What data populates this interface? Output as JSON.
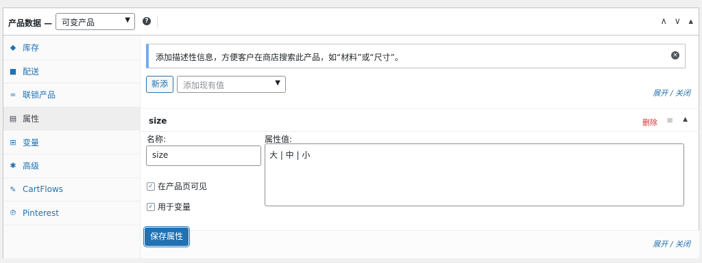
{
  "header": {
    "title": "产品数据 —",
    "product_type": "可变产品",
    "help_glyph": "?",
    "controls": [
      "∧",
      "∨",
      "▴"
    ]
  },
  "sidebar": {
    "items": [
      {
        "label": "库存",
        "icon": "tag-icon",
        "glyph": "◆"
      },
      {
        "label": "配送",
        "icon": "truck-icon",
        "glyph": "■"
      },
      {
        "label": "联锁产品",
        "icon": "link-icon",
        "glyph": "∞"
      },
      {
        "label": "属性",
        "icon": "list-icon",
        "glyph": "▤"
      },
      {
        "label": "变量",
        "icon": "grid-icon",
        "glyph": "⊞"
      },
      {
        "label": "高级",
        "icon": "gear-icon",
        "glyph": "✱"
      },
      {
        "label": "CartFlows",
        "icon": "wrench-icon",
        "glyph": "✎"
      },
      {
        "label": "Pinterest",
        "icon": "pinterest-icon",
        "glyph": "℗"
      }
    ],
    "active_index": 3
  },
  "notice": {
    "text": "添加描述性信息，方便客户在商店搜索此产品，如“材料”或“尺寸”。",
    "close_glyph": "×"
  },
  "toolbar": {
    "new_label": "新添",
    "existing_placeholder": "添加现有值",
    "expand_collapse": "展开 / 关闭"
  },
  "attribute": {
    "name_heading": "size",
    "delete_label": "删除",
    "drag_glyph": "≡",
    "toggle_glyph": "▲",
    "name_label": "名称:",
    "name_value": "size",
    "values_label": "属性值:",
    "values_value": "大 | 中 | 小",
    "visible_label": "在产品页可见",
    "visible_checked": true,
    "variation_label": "用于变量",
    "variation_checked": true,
    "check_glyph": "✓"
  },
  "footer": {
    "save_label": "保存属性",
    "expand_collapse": "展开 / 关闭"
  },
  "colors": {
    "accent": "#2271b1",
    "danger": "#d63638",
    "notice_border": "#72aee6"
  }
}
